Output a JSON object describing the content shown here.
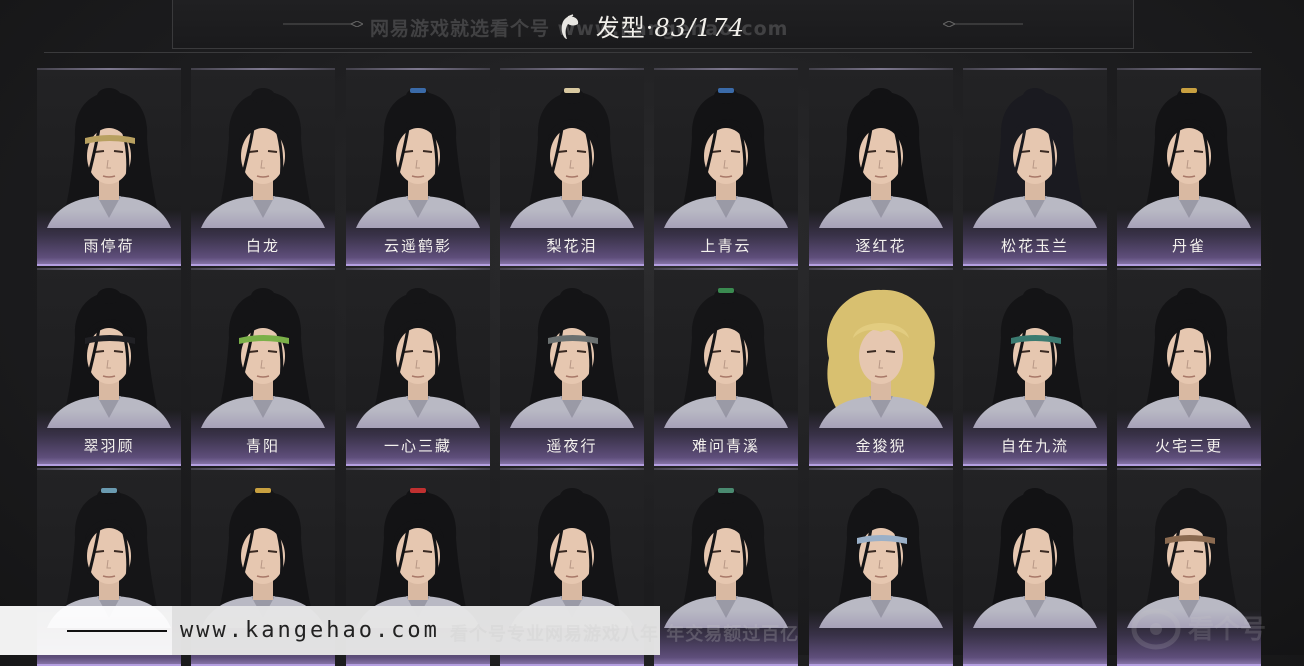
{
  "header": {
    "title": "发型",
    "separator": "·",
    "count": "83/174",
    "watermark": "网易游戏就选看个号 www.kangehao.com"
  },
  "cards": [
    {
      "name": "雨停荷",
      "hair": "#141416",
      "accent": "#b8a060",
      "band": true
    },
    {
      "name": "白龙",
      "hair": "#161618",
      "accent": "",
      "band": false
    },
    {
      "name": "云遥鹤影",
      "hair": "#141416",
      "accent": "#3a6aa8",
      "band": false
    },
    {
      "name": "梨花泪",
      "hair": "#151517",
      "accent": "#d8c8a0",
      "band": false
    },
    {
      "name": "上青云",
      "hair": "#131315",
      "accent": "#3a6aa8",
      "band": false
    },
    {
      "name": "逐红花",
      "hair": "#121214",
      "accent": "",
      "band": false
    },
    {
      "name": "松花玉兰",
      "hair": "#1a1a20",
      "accent": "",
      "band": false
    },
    {
      "name": "丹雀",
      "hair": "#131315",
      "accent": "#c8a040",
      "band": false
    },
    {
      "name": "翠羽顾",
      "hair": "#131315",
      "accent": "#202024",
      "band": true
    },
    {
      "name": "青阳",
      "hair": "#141416",
      "accent": "#7ab048",
      "band": true
    },
    {
      "name": "一心三藏",
      "hair": "#151517",
      "accent": "",
      "band": false
    },
    {
      "name": "遥夜行",
      "hair": "#141416",
      "accent": "#6a7070",
      "band": true
    },
    {
      "name": "难问青溪",
      "hair": "#151517",
      "accent": "#3a8a50",
      "band": false
    },
    {
      "name": "金狻猊",
      "hair": "#d8c070",
      "accent": "",
      "band": false
    },
    {
      "name": "自在九流",
      "hair": "#141416",
      "accent": "#3a7a70",
      "band": true
    },
    {
      "name": "火宅三更",
      "hair": "#131315",
      "accent": "",
      "band": false
    },
    {
      "name": "",
      "hair": "#151517",
      "accent": "#6a9ab0",
      "band": false
    },
    {
      "name": "",
      "hair": "#141416",
      "accent": "#c8a040",
      "band": false
    },
    {
      "name": "",
      "hair": "#131315",
      "accent": "#c03030",
      "band": false
    },
    {
      "name": "",
      "hair": "#141416",
      "accent": "",
      "band": false
    },
    {
      "name": "",
      "hair": "#151517",
      "accent": "#4a8a70",
      "band": false
    },
    {
      "name": "",
      "hair": "#141416",
      "accent": "#9ab0c8",
      "band": true
    },
    {
      "name": "",
      "hair": "#121214",
      "accent": "",
      "band": false
    },
    {
      "name": "",
      "hair": "#161618",
      "accent": "#8a6a50",
      "band": true
    }
  ],
  "banner": {
    "url": "www.kangehao.com",
    "watermark": "看个号专业网易游戏八年  年交易额过百亿",
    "logo_text": "看个号"
  }
}
